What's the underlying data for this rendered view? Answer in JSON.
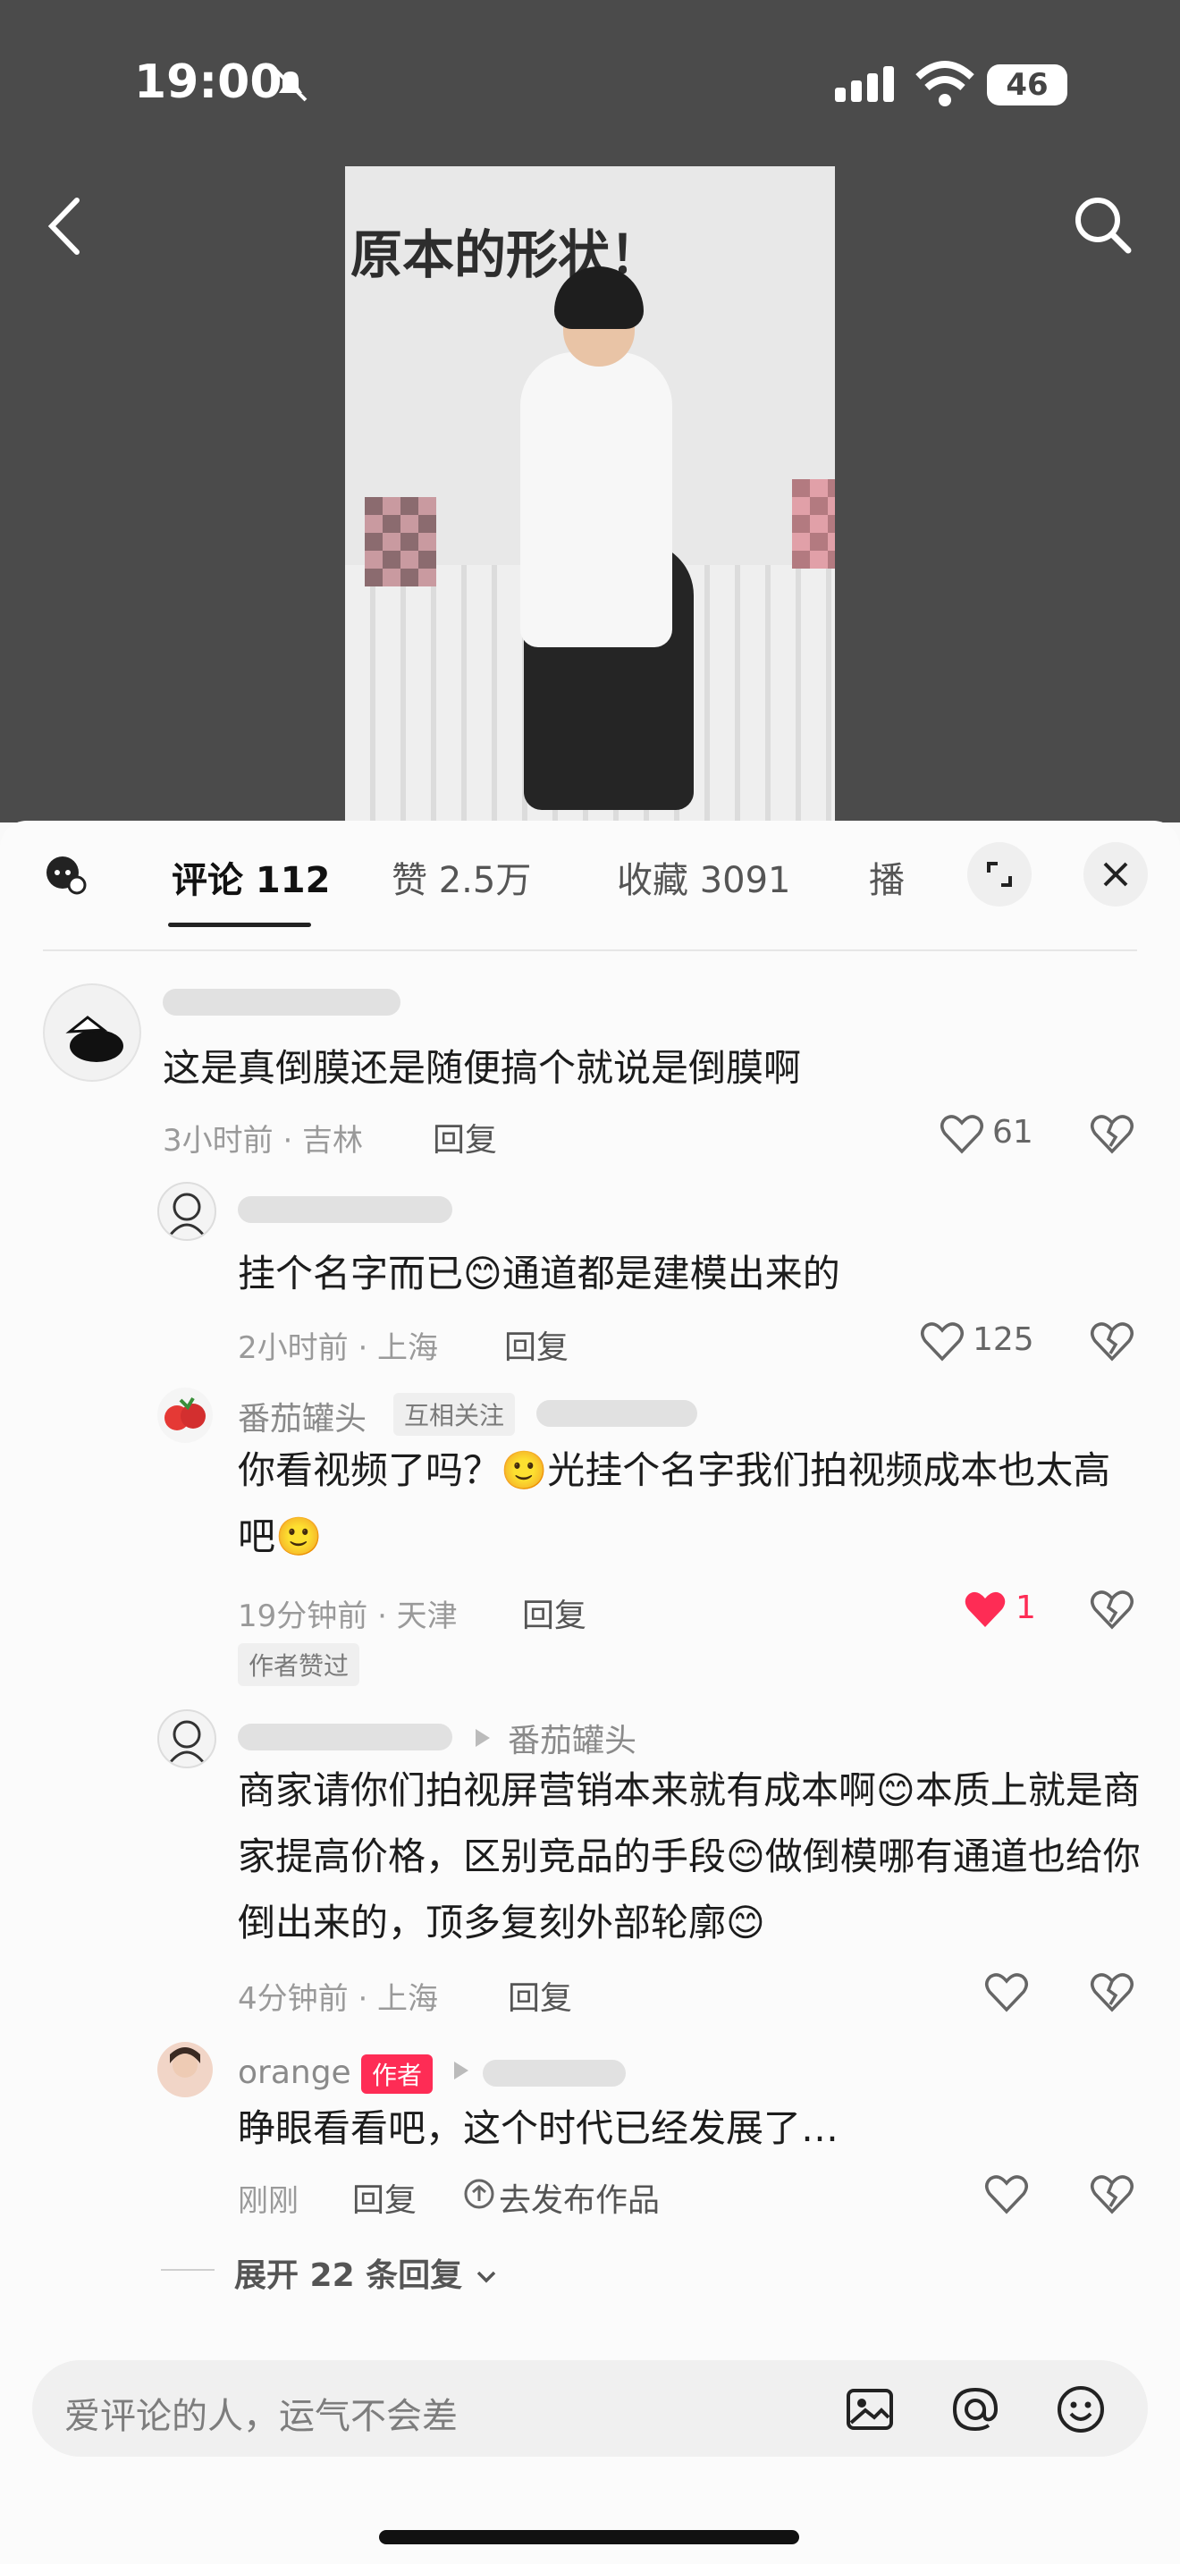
{
  "status": {
    "time": "19:00",
    "battery": "46"
  },
  "video": {
    "caption": "原本的形状！"
  },
  "tabs": [
    {
      "label": "评论 112"
    },
    {
      "label": "赞 2.5万"
    },
    {
      "label": "收藏 3091"
    },
    {
      "label": "播"
    }
  ],
  "comments": [
    {
      "text": "这是真倒膜还是随便搞个就说是倒膜啊",
      "meta": "3小时前 · 吉林",
      "reply": "回复",
      "likes": "61"
    },
    {
      "text": "挂个名字而已😊通道都是建模出来的",
      "meta": "2小时前 · 上海",
      "reply": "回复",
      "likes": "125"
    },
    {
      "name": "番茄罐头",
      "badge": "互相关注",
      "text": "你看视频了吗？🙂光挂个名字我们拍视频成本也太高吧🙂",
      "meta": "19分钟前 · 天津",
      "reply": "回复",
      "likes": "1",
      "liked_by_author": "作者赞过"
    },
    {
      "reply_to": "番茄罐头",
      "text": "商家请你们拍视屏营销本来就有成本啊😊本质上就是商家提高价格，区别竞品的手段😊做倒模哪有通道也给你倒出来的，顶多复刻外部轮廓😊",
      "meta": "4分钟前 · 上海",
      "reply": "回复"
    },
    {
      "name": "orange",
      "author_badge": "作者",
      "text": "睁眼看看吧，这个时代已经发展了…",
      "meta": "刚刚",
      "reply": "回复",
      "publish": "去发布作品"
    }
  ],
  "expand_replies": "展开 22 条回复",
  "input": {
    "placeholder": "爱评论的人，运气不会差"
  },
  "colors": {
    "like_red": "#fe2c55",
    "sheet_bg": "#fbfbfb"
  }
}
